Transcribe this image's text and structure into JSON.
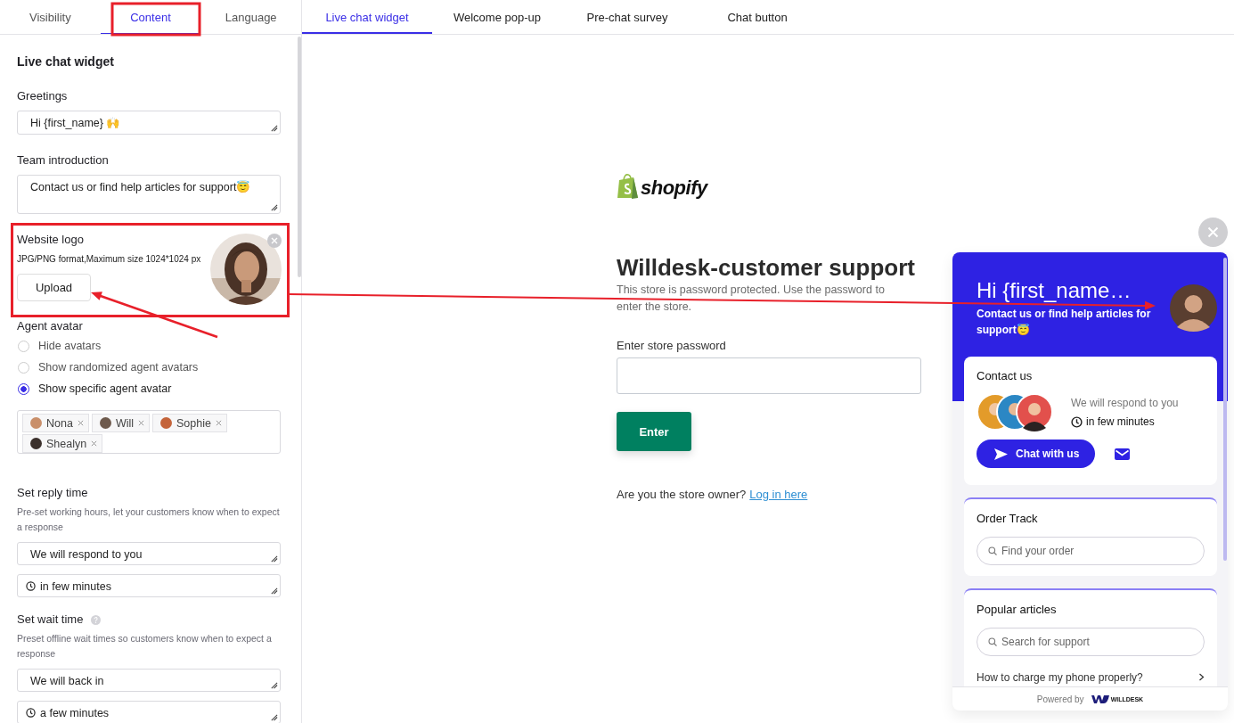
{
  "settings_tabs": [
    {
      "label": "Visibility",
      "selected": false
    },
    {
      "label": "Content",
      "selected": true
    },
    {
      "label": "Language",
      "selected": false
    }
  ],
  "preview_tabs": [
    {
      "label": "Live chat widget",
      "selected": true
    },
    {
      "label": "Welcome pop-up",
      "selected": false
    },
    {
      "label": "Pre-chat survey",
      "selected": false
    },
    {
      "label": "Chat button",
      "selected": false
    }
  ],
  "panel": {
    "title": "Live chat widget",
    "greetings": {
      "label": "Greetings",
      "value": "Hi {first_name} 🙌"
    },
    "team_introduction": {
      "label": "Team introduction",
      "value": "Contact us or find help articles for support😇"
    },
    "website_logo": {
      "label": "Website logo",
      "hint": "JPG/PNG format,Maximum size 1024*1024 px",
      "button": "Upload"
    },
    "agent_avatar": {
      "label": "Agent avatar",
      "options": [
        {
          "label": "Hide avatars",
          "selected": false
        },
        {
          "label": "Show randomized agent avatars",
          "selected": false
        },
        {
          "label": "Show specific agent avatar",
          "selected": true
        }
      ],
      "agents": [
        {
          "name": "Nona"
        },
        {
          "name": "Will"
        },
        {
          "name": "Sophie"
        },
        {
          "name": "Shealyn"
        }
      ]
    },
    "reply_time": {
      "label": "Set reply time",
      "description": "Pre-set working hours, let your customers know when to expect a response",
      "fields": [
        {
          "kind": "text",
          "value": "We will respond to you"
        },
        {
          "kind": "time",
          "value": "in few minutes"
        }
      ]
    },
    "wait_time": {
      "label": "Set wait time",
      "description": "Preset offline wait times so customers know when to expect a response",
      "help": true,
      "fields": [
        {
          "kind": "text",
          "value": "We will back in"
        },
        {
          "kind": "time",
          "value": "a few minutes"
        }
      ]
    }
  },
  "store": {
    "logo": "shopify",
    "title": "Willdesk-customer support",
    "description": "This store is password protected. Use the password to enter the store.",
    "password_label": "Enter store password",
    "button": "Enter",
    "owner_prompt": "Are you the store owner?",
    "login_link": "Log in here"
  },
  "widget": {
    "greeting": "Hi {first_name…",
    "intro": "Contact us or find help articles for support😇",
    "contact": {
      "title": "Contact us",
      "reply_text": "We will respond to you",
      "reply_time": "in few minutes",
      "button": "Chat with us"
    },
    "order_track": {
      "title": "Order Track",
      "placeholder": "Find your order"
    },
    "articles": {
      "title": "Popular articles",
      "placeholder": "Search for support",
      "items": [
        "How to charge my phone properly?"
      ]
    },
    "footer": {
      "label": "Powered by",
      "brand": "WILLDESK"
    }
  }
}
